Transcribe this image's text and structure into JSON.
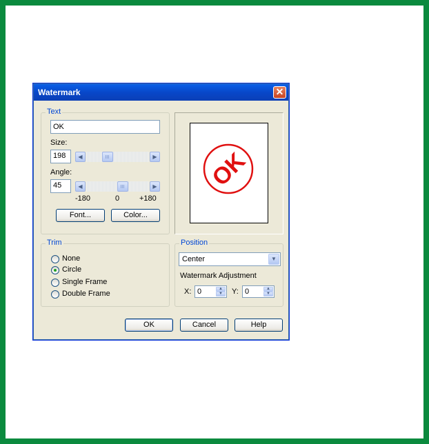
{
  "dialog": {
    "title": "Watermark",
    "close_glyph": "✕"
  },
  "text_group": {
    "label": "Text",
    "text_value": "OK",
    "size_label": "Size:",
    "size_value": "198",
    "angle_label": "Angle:",
    "angle_value": "45",
    "tick_min": "-180",
    "tick_mid": "0",
    "tick_max": "+180",
    "font_button": "Font...",
    "color_button": "Color..."
  },
  "preview": {
    "stamp_text": "OK",
    "stamp_color": "#e01010"
  },
  "trim_group": {
    "label": "Trim",
    "options": [
      "None",
      "Circle",
      "Single Frame",
      "Double Frame"
    ],
    "selected": "Circle"
  },
  "position_group": {
    "label": "Position",
    "selected": "Center",
    "adjust_label": "Watermark Adjustment",
    "x_label": "X:",
    "x_value": "0",
    "y_label": "Y:",
    "y_value": "0"
  },
  "buttons": {
    "ok": "OK",
    "cancel": "Cancel",
    "help": "Help"
  },
  "colors": {
    "frame_border": "#0b8a3e",
    "titlebar": "#0847c9",
    "group_label": "#0046d5",
    "dialog_bg": "#ece9d8"
  }
}
